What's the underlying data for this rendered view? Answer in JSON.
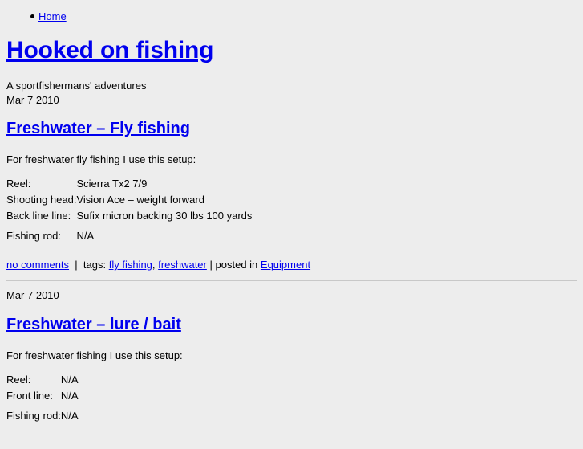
{
  "site": {
    "title": "Hooked on fishing",
    "tagline": "A sportfishermans' adventures",
    "tagline_date": "Mar 7 2010"
  },
  "nav": {
    "items": [
      {
        "label": "Home"
      }
    ]
  },
  "posts": [
    {
      "date": "",
      "title": "Freshwater – Fly fishing",
      "intro": "For freshwater fly fishing I use this setup:",
      "specs": [
        {
          "label": "Reel:",
          "value": "Scierra Tx2 7/9",
          "gap": false
        },
        {
          "label": "Shooting head:",
          "value": "Vision Ace – weight forward",
          "gap": false
        },
        {
          "label": "Back line line:",
          "value": "Sufix micron backing 30 lbs 100 yards",
          "gap": false
        },
        {
          "label": "Fishing rod:",
          "value": "N/A",
          "gap": true
        }
      ],
      "meta": {
        "comments": "no comments",
        "sep1": "|",
        "tags_label": "tags:",
        "tags": [
          {
            "label": "fly fishing"
          },
          {
            "label": "freshwater"
          }
        ],
        "tag_separator": ",",
        "sep2": "|",
        "posted_in_label": "posted in",
        "category": "Equipment"
      }
    },
    {
      "date": "Mar 7 2010",
      "title": "Freshwater – lure / bait",
      "intro": "For freshwater fishing I use this setup:",
      "specs": [
        {
          "label": "Reel:",
          "value": "N/A",
          "gap": false
        },
        {
          "label": "Front line:",
          "value": "N/A",
          "gap": false
        },
        {
          "label": "Fishing rod:",
          "value": "N/A",
          "gap": true
        }
      ]
    }
  ],
  "colors": {
    "background": "#ededed",
    "link": "#0000ee",
    "text": "#000000",
    "divider": "#c8c8c8"
  }
}
